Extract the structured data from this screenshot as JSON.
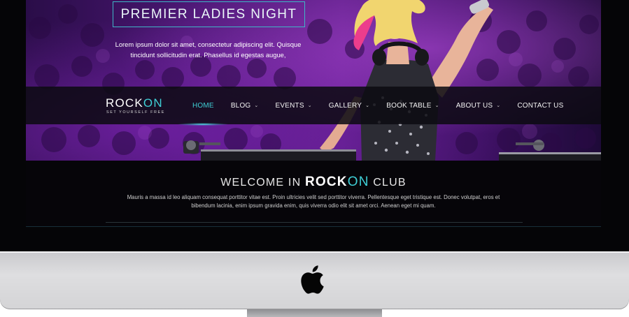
{
  "hero": {
    "title": "PREMIER LADIES NIGHT",
    "text": "Lorem ipsum dolor sit amet, consectetur adipiscing elit. Quisque tincidunt sollicitudin erat. Phasellus id egestas augue,"
  },
  "logo": {
    "part1": "ROCK",
    "part2": "ON",
    "tagline": "SET YOURSELF FREE"
  },
  "nav": {
    "items": [
      {
        "label": "HOME",
        "dropdown": false,
        "active": true
      },
      {
        "label": "BLOG",
        "dropdown": true,
        "active": false
      },
      {
        "label": "EVENTS",
        "dropdown": true,
        "active": false
      },
      {
        "label": "GALLERY",
        "dropdown": true,
        "active": false
      },
      {
        "label": "BOOK TABLE",
        "dropdown": true,
        "active": false
      },
      {
        "label": "ABOUT US",
        "dropdown": true,
        "active": false
      },
      {
        "label": "CONTACT US",
        "dropdown": false,
        "active": false
      }
    ],
    "dropdown_glyph": "⌄"
  },
  "welcome": {
    "pre": "WELCOME IN",
    "brand1": "ROCK",
    "brand2": "ON",
    "post": "CLUB",
    "text": "Mauris a massa id leo aliquam consequat porttitor vitae est. Proin ultricies velit sed porttitor viverra. Pellentesque eget tristique est. Donec volutpat, eros et bibendum lacinia, enim ipsum gravida enim, quis viverra odio elit sit amet orci. Aenean eget mi quam."
  },
  "colors": {
    "accent": "#3fcfd6",
    "hero_purple": "#5b1d85",
    "navbar": "#0c0a12",
    "bezel": "#050507",
    "chin": "#d6d6d8"
  },
  "icons": {
    "apple": "apple-logo-icon",
    "caret": "chevron-down-icon"
  }
}
